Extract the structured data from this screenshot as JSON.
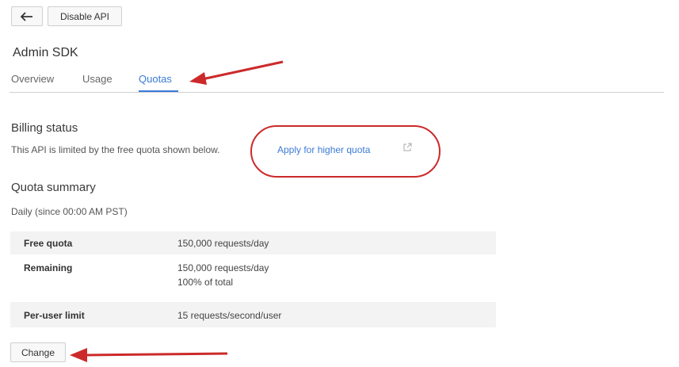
{
  "toolbar": {
    "back_icon": "arrow-back-icon",
    "disable_label": "Disable API"
  },
  "page": {
    "title": "Admin SDK"
  },
  "tabs": [
    {
      "label": "Overview",
      "active": false
    },
    {
      "label": "Usage",
      "active": false
    },
    {
      "label": "Quotas",
      "active": true
    }
  ],
  "billing": {
    "heading": "Billing status",
    "text": "This API is limited by the free quota shown below.",
    "link": "Apply for higher quota",
    "link_icon": "external-link-icon"
  },
  "quota": {
    "heading": "Quota summary",
    "period": "Daily (since 00:00 AM PST)",
    "rows": [
      {
        "label": "Free quota",
        "value": "150,000 requests/day",
        "value2": ""
      },
      {
        "label": "Remaining",
        "value": "150,000 requests/day",
        "value2": "100% of total"
      },
      {
        "label": "Per-user limit",
        "value": "15 requests/second/user",
        "value2": ""
      }
    ]
  },
  "actions": {
    "change_label": "Change"
  },
  "colors": {
    "accent": "#3b7bd8",
    "annotation": "#cc2a2a"
  }
}
